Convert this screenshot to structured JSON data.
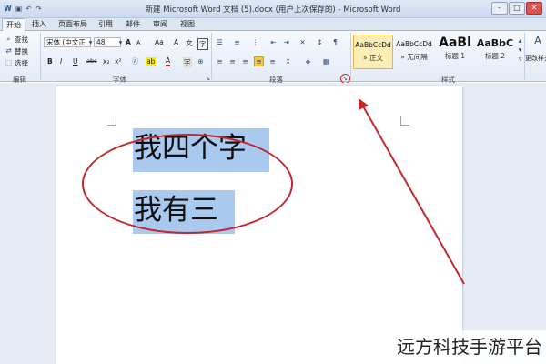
{
  "window": {
    "title": "新建 Microsoft Word 文档 (5).docx (用户上次保存的) - Microsoft Word",
    "controls": {
      "minimize": "–",
      "maximize": "□",
      "close": "✕"
    }
  },
  "tabs": [
    {
      "label": "开始",
      "active": true
    },
    {
      "label": "插入",
      "active": false
    },
    {
      "label": "页面布局",
      "active": false
    },
    {
      "label": "引用",
      "active": false
    },
    {
      "label": "邮件",
      "active": false
    },
    {
      "label": "审阅",
      "active": false
    },
    {
      "label": "视图",
      "active": false
    }
  ],
  "ribbon": {
    "clipboard": {
      "items": [
        "查找",
        "替换",
        "选择"
      ],
      "group_label": "编辑"
    },
    "font": {
      "font_name": "宋体 (中文正",
      "font_size": "48",
      "grow_label": "A",
      "shrink_label": "A",
      "bold_label": "B",
      "italic_label": "I",
      "underline_label": "U",
      "strike_label": "abc",
      "subscript_label": "x₂",
      "superscript_label": "x²",
      "highlight_label": "ab",
      "color_label": "A",
      "change_case_label": "Aa",
      "clear_label": "A",
      "phonetic_label": "文",
      "enclose_label": "字",
      "group_label": "字体"
    },
    "paragraph": {
      "group_label": "段落"
    },
    "styles": {
      "items": [
        {
          "sample": "AaBbCcDd",
          "name": "» 正文",
          "selected": true
        },
        {
          "sample": "AaBbCcDd",
          "name": "» 无间隔",
          "selected": false
        },
        {
          "sample": "AaBl",
          "name": "标题 1",
          "selected": false
        },
        {
          "sample": "AaBbC",
          "name": "标题 2",
          "selected": false
        }
      ],
      "change_styles_label": "更改样式",
      "group_label": "样式"
    }
  },
  "document": {
    "lines": [
      "我四个字",
      "我有三"
    ]
  },
  "watermark": "远方科技手游平台",
  "annotation": {
    "oval_color": "#c1272d",
    "arrow_color": "#c1272d"
  },
  "colors": {
    "selection": "#a9c9ef",
    "ribbon": "#e3ebf6",
    "style_selected": "#fdeeb6"
  }
}
